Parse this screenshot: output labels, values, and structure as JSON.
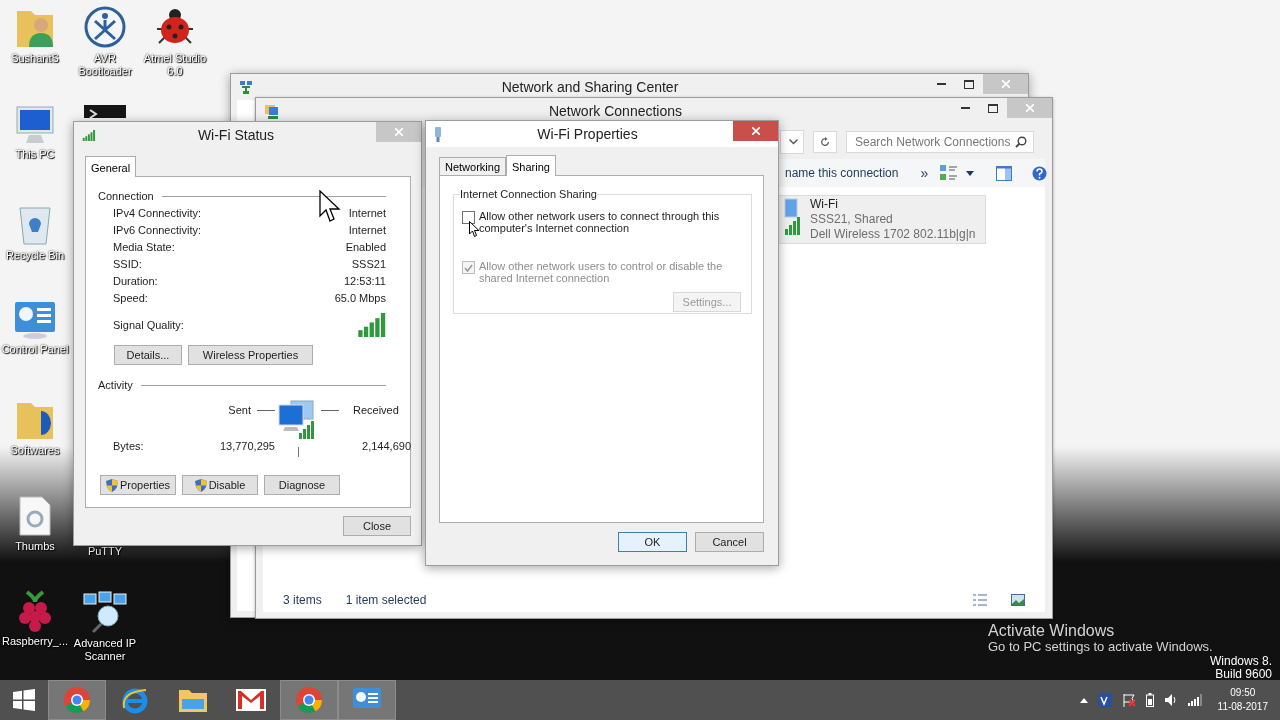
{
  "desktop_icons": [
    {
      "label": "SushantS",
      "kind": "user-folder"
    },
    {
      "label": "AVR Bootloader",
      "kind": "avr"
    },
    {
      "label": "Atmel Studio 6.0",
      "kind": "ladybug"
    },
    {
      "label": "This PC",
      "kind": "pc"
    },
    {
      "kind": "terminal"
    },
    {
      "label": "Recycle Bin",
      "kind": "recycle-bin"
    },
    {
      "label": "Control Panel",
      "kind": "control-panel"
    },
    {
      "label": "Softwares",
      "kind": "folder"
    },
    {
      "label": "Thumbs",
      "kind": "document"
    },
    {
      "label": "PuTTY",
      "kind": "covered"
    },
    {
      "label": "Raspberry_...",
      "kind": "raspberry"
    },
    {
      "label": "Advanced IP Scanner",
      "kind": "network-scan"
    }
  ],
  "sharing_center": {
    "title": "Network and Sharing Center"
  },
  "network_connections": {
    "title": "Network Connections",
    "search": {
      "placeholder": "Search Network Connections"
    },
    "toolbar": {
      "command": "name this connection",
      "more": "»"
    },
    "items": [
      {
        "name": "Wi-Fi",
        "status": "SSS21, Shared",
        "device": "Dell Wireless 1702 802.11b|g|n",
        "selected": true
      }
    ],
    "status_bar": {
      "count": "3 items",
      "selection": "1 item selected"
    }
  },
  "wifi_status": {
    "title": "Wi-Fi Status",
    "tabs": [
      {
        "label": "General",
        "selected": true
      }
    ],
    "connection": {
      "heading": "Connection",
      "rows": [
        {
          "label": "IPv4 Connectivity:",
          "value": "Internet"
        },
        {
          "label": "IPv6 Connectivity:",
          "value": "Internet"
        },
        {
          "label": "Media State:",
          "value": "Enabled"
        },
        {
          "label": "SSID:",
          "value": "SSS21"
        },
        {
          "label": "Duration:",
          "value": "12:53:11"
        },
        {
          "label": "Speed:",
          "value": "65.0 Mbps"
        }
      ],
      "signal_label": "Signal Quality:",
      "buttons": [
        "Details...",
        "Wireless Properties"
      ]
    },
    "activity": {
      "heading": "Activity",
      "sent_label": "Sent",
      "received_label": "Received",
      "bytes_label": "Bytes:",
      "sent": "13,770,295",
      "received": "2,144,690"
    },
    "buttons": [
      {
        "label": "Properties",
        "shield": true
      },
      {
        "label": "Disable",
        "shield": true
      },
      {
        "label": "Diagnose",
        "shield": false
      }
    ],
    "close": "Close"
  },
  "wifi_properties": {
    "title": "Wi-Fi Properties",
    "tabs": [
      {
        "label": "Networking",
        "selected": false
      },
      {
        "label": "Sharing",
        "selected": true
      }
    ],
    "group": "Internet Connection Sharing",
    "options": [
      {
        "label": "Allow other network users to connect through this computer's Internet connection",
        "checked": false,
        "disabled": false
      },
      {
        "label": "Allow other network users to control or disable the shared Internet connection",
        "checked": true,
        "disabled": true
      }
    ],
    "settings_button": {
      "label": "Settings...",
      "disabled": true
    },
    "buttons": [
      {
        "label": "OK",
        "default": true
      },
      {
        "label": "Cancel",
        "default": false
      }
    ]
  },
  "activation": {
    "title": "Activate Windows",
    "hint": "Go to PC settings to activate Windows.",
    "edition": "Windows 8.",
    "build": "Build 9600"
  },
  "taskbar": {
    "apps": [
      {
        "kind": "browser",
        "active": true
      },
      {
        "kind": "ie",
        "active": false
      },
      {
        "kind": "explorer",
        "active": false
      },
      {
        "kind": "mail",
        "active": false
      },
      {
        "kind": "browser",
        "active": true
      },
      {
        "kind": "control-panel",
        "active": true
      }
    ],
    "time": "09:50",
    "date": "11-08-2017"
  }
}
